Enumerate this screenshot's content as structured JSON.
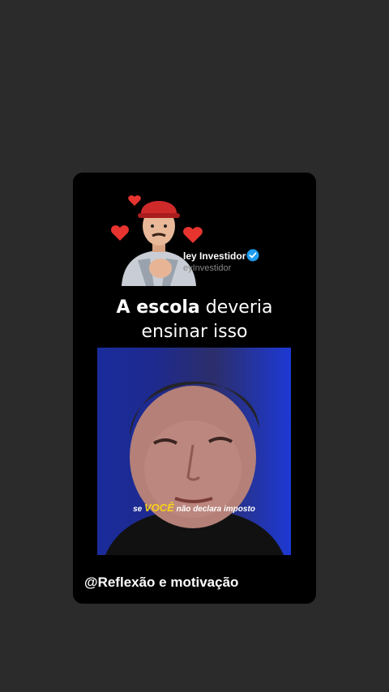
{
  "profile": {
    "name": "ley Investidor",
    "handle": "eyInvestidor"
  },
  "headline": {
    "bold": "A escola",
    "rest1": " deveria",
    "line2": "ensinar isso"
  },
  "video": {
    "caption_pre": "se ",
    "caption_highlight": "VOCÊ",
    "caption_post": " não declara imposto"
  },
  "footer": {
    "text": "@Reflexão e motivação"
  },
  "icons": [
    "heart-icon",
    "verified-badge-icon",
    "avatar-sticker-icon"
  ]
}
